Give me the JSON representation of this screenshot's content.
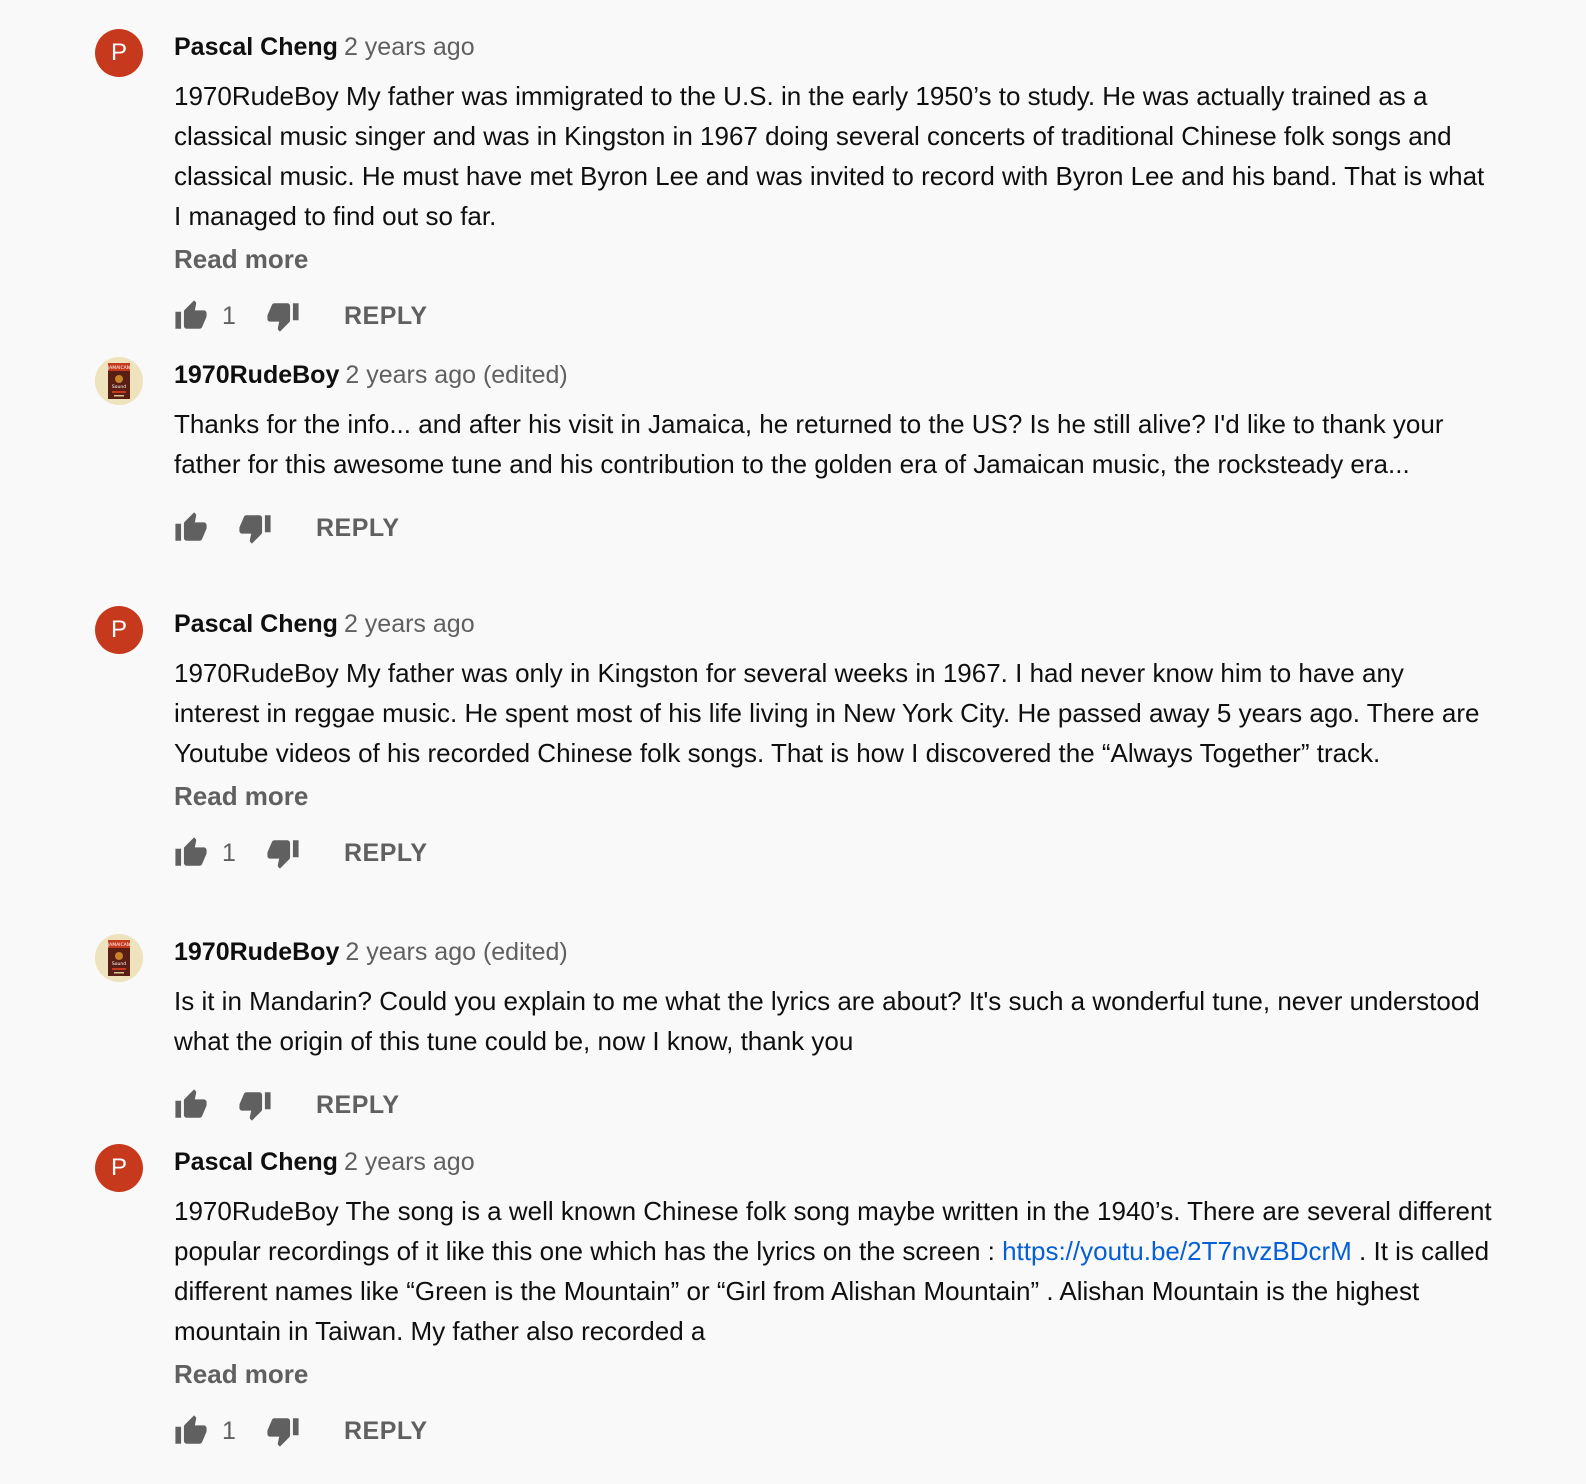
{
  "comments": [
    {
      "author": "Pascal Cheng",
      "avatar_letter": "P",
      "time": "2 years ago",
      "text": "1970RudeBoy My father was immigrated to the U.S. in the early 1950’s to study. He was actually trained as a classical music singer and was in Kingston in 1967 doing several concerts of traditional Chinese folk songs and classical music. He must have met Byron Lee and was invited to record with Byron Lee and his band. That is what I managed to find out so far.",
      "read_more": "Read more",
      "likes": "1",
      "reply": "REPLY"
    },
    {
      "author": "1970RudeBoy",
      "time": "2 years ago (edited)",
      "text": "Thanks for the info... and after his visit in Jamaica, he returned to the US? Is he still alive? I'd like to thank your father for this awesome tune and his contribution to the golden era of Jamaican music, the rocksteady era...",
      "reply": "REPLY"
    },
    {
      "author": "Pascal Cheng",
      "avatar_letter": "P",
      "time": "2 years ago",
      "text": "1970RudeBoy My father was only in Kingston for several weeks in 1967. I had never know him to have any interest in reggae music. He spent most of his life living in New York City. He passed away 5 years ago. There are Youtube videos of his recorded Chinese folk songs. That is how I discovered the “Always Together” track.",
      "read_more": "Read more",
      "likes": "1",
      "reply": "REPLY"
    },
    {
      "author": "1970RudeBoy",
      "time": "2 years ago (edited)",
      "text": "Is it in Mandarin? Could you explain to me what the lyrics are about?  It's such a wonderful tune, never understood what the origin of this tune could be, now I know, thank you",
      "reply": "REPLY"
    },
    {
      "author": "Pascal Cheng",
      "avatar_letter": "P",
      "time": "2 years ago",
      "text_before_link": "1970RudeBoy The song is a well known Chinese folk song maybe written in the 1940’s. There are several different popular recordings of it like this one which has the lyrics on the screen : ",
      "link": "https://youtu.be/2T7nvzBDcrM",
      "text_after_link": " . It is called different names like “Green is the Mountain” or “Girl from Alishan Mountain” . Alishan Mountain is the highest mountain in Taiwan. My father also recorded a",
      "read_more": "Read more",
      "likes": "1",
      "reply": "REPLY"
    }
  ],
  "avatar_image_lettering": [
    "JAMAICAN",
    "Sound"
  ],
  "colors": {
    "avatar_red": "#c6391c",
    "link_blue": "#065fd4",
    "secondary_text": "#606060",
    "background": "#f9f9f9"
  },
  "icons": [
    "thumb-up-icon",
    "thumb-down-icon"
  ]
}
